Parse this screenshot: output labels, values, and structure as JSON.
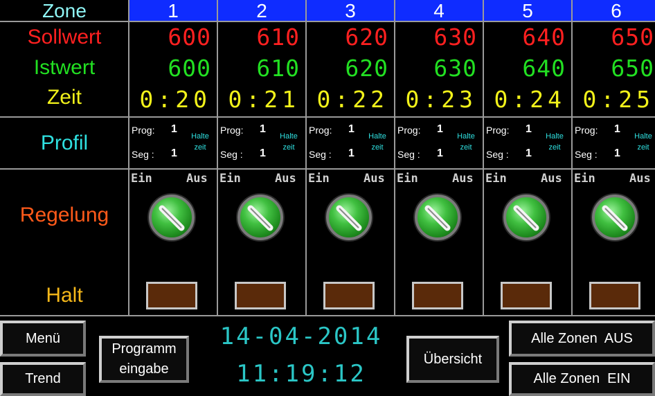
{
  "header": {
    "zone_label": "Zone"
  },
  "labels": {
    "sollwert": "Sollwert",
    "istwert": "Istwert",
    "zeit": "Zeit",
    "profil": "Profil",
    "regelung": "Regelung",
    "halt": "Halt"
  },
  "profil_text": {
    "prog": "Prog:",
    "seg": "Seg :",
    "halte_1": "Halte",
    "halte_2": "zeit"
  },
  "switch_text": {
    "ein": "Ein",
    "aus": "Aus"
  },
  "zones": [
    {
      "num": "1",
      "sollwert": "600",
      "istwert": "600",
      "zeit": "0:20",
      "prog": "1",
      "seg": "1"
    },
    {
      "num": "2",
      "sollwert": "610",
      "istwert": "610",
      "zeit": "0:21",
      "prog": "1",
      "seg": "1"
    },
    {
      "num": "3",
      "sollwert": "620",
      "istwert": "620",
      "zeit": "0:22",
      "prog": "1",
      "seg": "1"
    },
    {
      "num": "4",
      "sollwert": "630",
      "istwert": "630",
      "zeit": "0:23",
      "prog": "1",
      "seg": "1"
    },
    {
      "num": "5",
      "sollwert": "640",
      "istwert": "640",
      "zeit": "0:24",
      "prog": "1",
      "seg": "1"
    },
    {
      "num": "6",
      "sollwert": "650",
      "istwert": "650",
      "zeit": "0:25",
      "prog": "1",
      "seg": "1"
    }
  ],
  "buttons": {
    "menu": "Menü",
    "trend": "Trend",
    "programm_1": "Programm",
    "programm_2": "eingabe",
    "uebersicht": "Übersicht",
    "alle_aus": "Alle Zonen  AUS",
    "alle_ein": "Alle Zonen  EIN"
  },
  "status": {
    "date": "14-04-2014",
    "time": "11:19:12"
  },
  "colors": {
    "zone_header": "#0f2cff",
    "sollwert": "#ff2020",
    "istwert": "#22e022",
    "zeit": "#f2f21a",
    "profil": "#2fe0e0",
    "regelung": "#ff5a1a",
    "halt": "#f5b81a",
    "clock": "#2bc6c6"
  }
}
